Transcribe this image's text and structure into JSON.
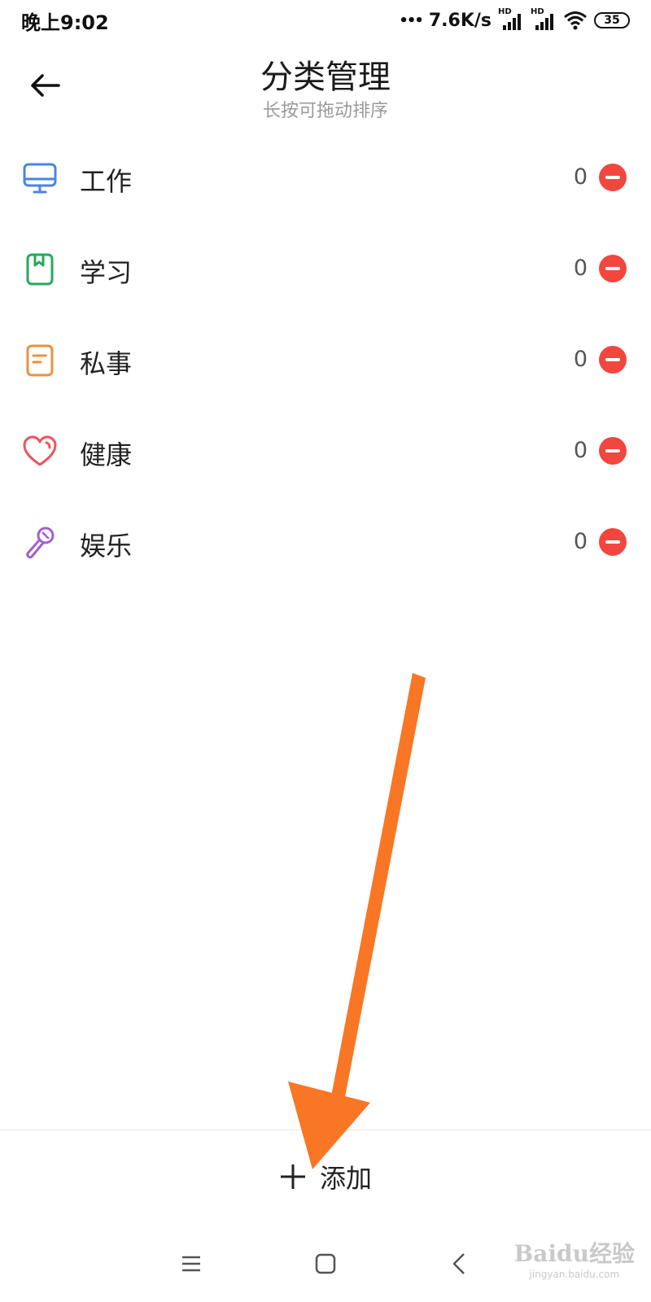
{
  "status_bar": {
    "time": "晚上9:02",
    "network_speed": "7.6K/s",
    "signal_label": "HD",
    "battery": "35"
  },
  "header": {
    "title": "分类管理",
    "subtitle": "长按可拖动排序"
  },
  "categories": [
    {
      "name": "工作",
      "count": "0",
      "icon": "monitor-icon",
      "color": "#4a86e0"
    },
    {
      "name": "学习",
      "count": "0",
      "icon": "bookmark-book-icon",
      "color": "#27a85a"
    },
    {
      "name": "私事",
      "count": "0",
      "icon": "note-icon",
      "color": "#ef8f3d"
    },
    {
      "name": "健康",
      "count": "0",
      "icon": "heart-icon",
      "color": "#e8565c"
    },
    {
      "name": "娱乐",
      "count": "0",
      "icon": "microphone-icon",
      "color": "#a25ed1"
    }
  ],
  "add_bar": {
    "label": "添加"
  },
  "watermark": {
    "top": "Baidu经验",
    "bottom": "jingyan.baidu.com"
  },
  "colors": {
    "remove": "#f2463f",
    "arrow": "#f97625"
  }
}
